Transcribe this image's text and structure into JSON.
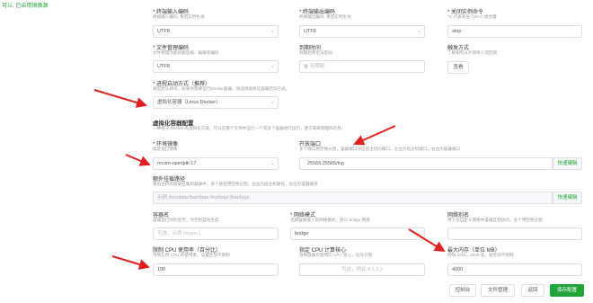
{
  "top_note": "可以, 已启用镜像源",
  "row1": {
    "input_encoding": {
      "label": "* 终端输入编码",
      "desc": "终端输入编码, 重启实例生效",
      "value": "UTF8"
    },
    "output_encoding": {
      "label": "* 终端输出编码",
      "desc": "终端输出编码, 重启实例生效",
      "value": "UTF8"
    },
    "stop_cmd": {
      "label": "* 关闭实例命令",
      "desc": "^C 代表发送 Ctrl+C 组合键",
      "value": "stop"
    }
  },
  "row2": {
    "file_encoding": {
      "label": "* 文件管理编码",
      "desc": "文件管理功能的解压缩、编辑等编码",
      "value": "UTF8"
    },
    "expire_time": {
      "label": "到期时间",
      "desc": "到期后将无法启动",
      "placeholder": "无限制"
    },
    "trigger": {
      "label": "触发方式",
      "desc": "了解如何从外部接入或回调",
      "button": "查看"
    }
  },
  "process_mode": {
    "label": "* 进程启动方式（推荐）",
    "desc": "通常默认即可，如果你需要运行Docker容器，请选择虚拟化容器启动方式。",
    "value": "虚拟化容器（Linux Docker）"
  },
  "virtualization": {
    "title": "虚拟化容器配置",
    "desc": "一种基于 Docker 的虚拟化方案，可以在整个实例中运行一个或多个容器进行运行，便于隔离管理和迁移。"
  },
  "image": {
    "label": "* 环境镜像",
    "desc": "指定运行镜像",
    "value": "mcsm-openjdk:17"
  },
  "ports": {
    "label": "开放端口",
    "desc": "多个端口用空格分割，容器端口对应宿主机的端口，左边为宿主机端口，右边为容器端口",
    "value": "25565:25565/tcp",
    "quick": "快速编辑"
  },
  "mounts": {
    "label": "额外挂载路径",
    "desc": "将宿主机的目录挂载到容器中，多个路径用空格分割，左边为宿主机路径，右边为容器路径",
    "placeholder": "示例 /foo/data:/bar/data /foo/logs:/bar/logs",
    "quick": "快速编辑"
  },
  "container": {
    "label": "容器名",
    "desc": "容器运行时的名字，为空则自动生成",
    "placeholder": "可选，示例 mcsm-1"
  },
  "network_mode": {
    "label": "* 网络模式",
    "desc": "选择容器接入的网络模式，默认 bridge 网络",
    "value": "bridge"
  },
  "network_alias": {
    "label": "网络别名",
    "desc": "用于在自定义网络中容器互相访问，多个用空格分割",
    "placeholder": ""
  },
  "cpu_usage": {
    "label": "限制 CPU 使用率（百分比）",
    "desc": "限制实例 CPU 的使用率，设置空值不限制",
    "value": "100"
  },
  "cpu_cores": {
    "label": "指定 CPU 计算核心",
    "desc": "限制容器可使用的 CPU 核心，逗号分割",
    "placeholder": "可选，例如 0,1,2,3"
  },
  "memory": {
    "label": "最大内存（单位 MB）",
    "desc": "例如 1024，2048 等，留空则不限制",
    "value": "4000"
  },
  "actions": {
    "console": "控制台",
    "files": "文件管理",
    "back": "返回",
    "save": "保存配置"
  }
}
